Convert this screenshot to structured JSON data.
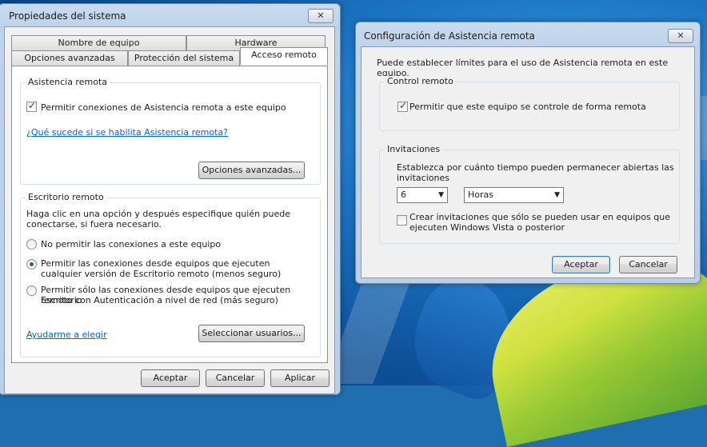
{
  "main_window": {
    "title": "Propiedades del sistema",
    "close_label": "✕",
    "tabs_row1": [
      "Nombre de equipo",
      "Hardware"
    ],
    "tabs_row2": [
      "Opciones avanzadas",
      "Protección del sistema",
      "Acceso remoto"
    ],
    "asistencia": {
      "group_title": "Asistencia remota",
      "checkbox_label": "Permitir conexiones de Asistencia remota a este equipo",
      "checked": true,
      "link": "¿Qué sucede si se habilita Asistencia remota?",
      "advanced_button": "Opciones avanzadas..."
    },
    "escritorio": {
      "group_title": "Escritorio remoto",
      "description_1": "Haga clic en una opción y después especifique quién puede",
      "description_2": "conectarse, si fuera necesario.",
      "options": [
        {
          "line1": "No permitir las conexiones a este equipo",
          "line2": "",
          "selected": false
        },
        {
          "line1": "Permitir las conexiones desde equipos que ejecuten",
          "line2": "cualquier versión de Escritorio remoto (menos seguro)",
          "selected": true
        },
        {
          "line1": "Permitir sólo las conexiones desde equipos que ejecuten Escritorio",
          "line2": "remoto con Autenticación a nivel de red (más seguro)",
          "selected": false
        }
      ],
      "help_link": "Ayudarme a elegir",
      "select_users_button": "Seleccionar usuarios..."
    },
    "buttons": {
      "ok": "Aceptar",
      "cancel": "Cancelar",
      "apply": "Aplicar"
    }
  },
  "dialog": {
    "title": "Configuración de Asistencia remota",
    "close_label": "✕",
    "intro": "Puede establecer límites para el uso de Asistencia remota en este equipo.",
    "control": {
      "group_title": "Control remoto",
      "checkbox_label": "Permitir que este equipo se controle de forma remota",
      "checked": true
    },
    "invitations": {
      "group_title": "Invitaciones",
      "text_1": "Establezca por cuánto tiempo pueden permanecer abiertas las",
      "text_2": "invitaciones",
      "amount_value": "6",
      "unit_value": "Horas",
      "vista_checkbox_1": "Crear invitaciones que sólo se pueden usar en equipos que",
      "vista_checkbox_2": "ejecuten Windows Vista o posterior",
      "vista_checked": false
    },
    "buttons": {
      "ok": "Aceptar",
      "cancel": "Cancelar"
    }
  }
}
